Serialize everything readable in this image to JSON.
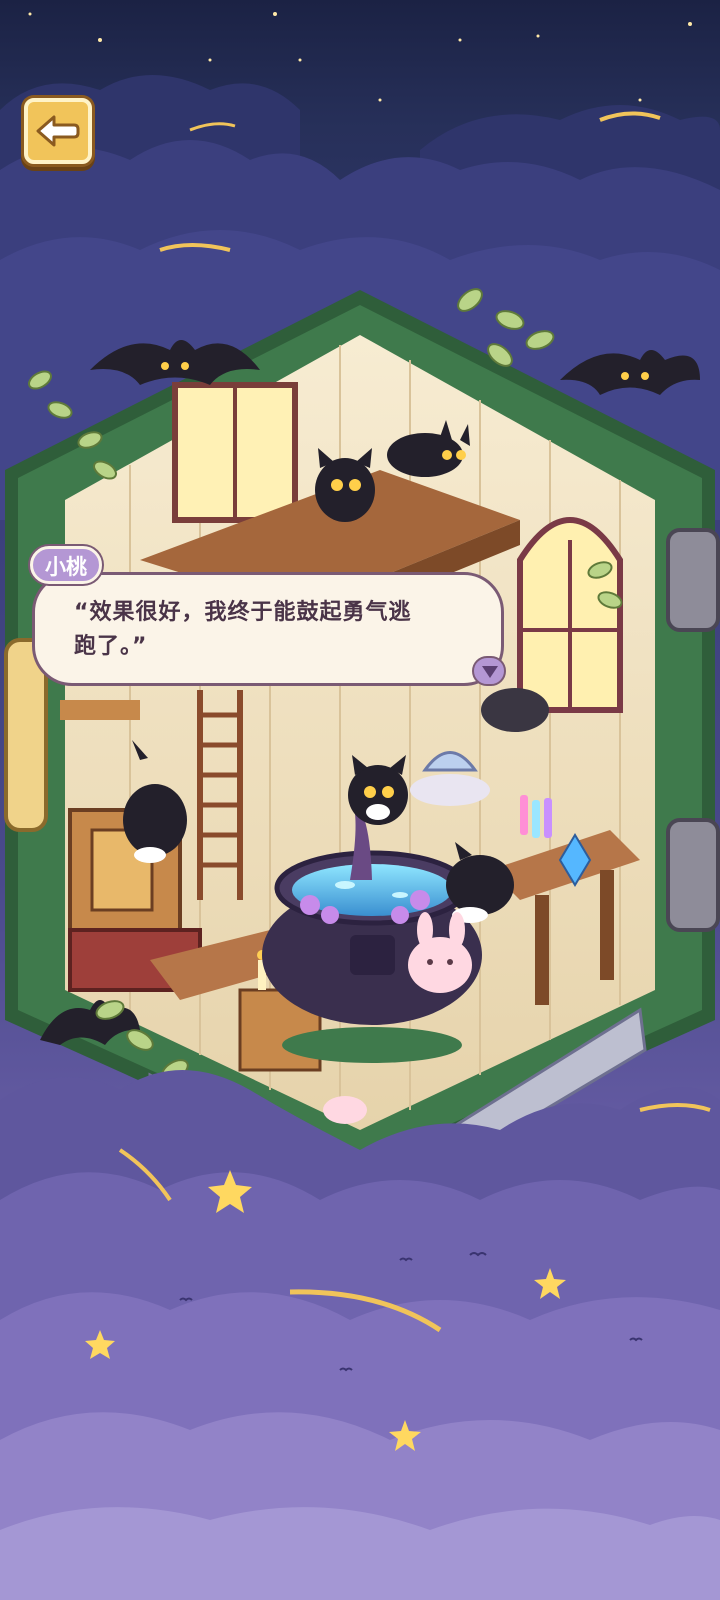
{
  "scene": {
    "name": "witch-room",
    "colors": {
      "sky_top": "#1b2244",
      "cloud_dark": "#3d3f80",
      "cloud_light": "#8b78c0",
      "frame_green": "#3f7a4c",
      "wall_cream": "#f3e6c8",
      "cauldron_liquid": "#63c7e8",
      "accent_gold": "#f1c45a"
    }
  },
  "back_button": {
    "icon": "back-arrow-icon"
  },
  "dialogue": {
    "speaker": "小桃",
    "text_line1": "“效果很好，我终于能鼓起勇气逃",
    "text_line2": "跑了。”",
    "next_icon": "triangle-down-icon"
  }
}
